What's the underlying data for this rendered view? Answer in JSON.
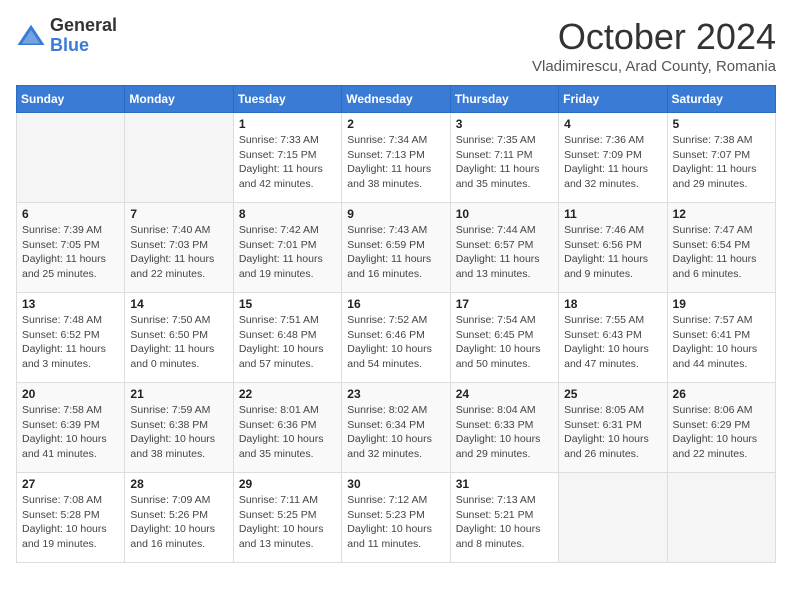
{
  "header": {
    "logo_general": "General",
    "logo_blue": "Blue",
    "month_title": "October 2024",
    "subtitle": "Vladimirescu, Arad County, Romania"
  },
  "days_of_week": [
    "Sunday",
    "Monday",
    "Tuesday",
    "Wednesday",
    "Thursday",
    "Friday",
    "Saturday"
  ],
  "weeks": [
    [
      {
        "day": "",
        "sunrise": "",
        "sunset": "",
        "daylight": ""
      },
      {
        "day": "",
        "sunrise": "",
        "sunset": "",
        "daylight": ""
      },
      {
        "day": "1",
        "sunrise": "Sunrise: 7:33 AM",
        "sunset": "Sunset: 7:15 PM",
        "daylight": "Daylight: 11 hours and 42 minutes."
      },
      {
        "day": "2",
        "sunrise": "Sunrise: 7:34 AM",
        "sunset": "Sunset: 7:13 PM",
        "daylight": "Daylight: 11 hours and 38 minutes."
      },
      {
        "day": "3",
        "sunrise": "Sunrise: 7:35 AM",
        "sunset": "Sunset: 7:11 PM",
        "daylight": "Daylight: 11 hours and 35 minutes."
      },
      {
        "day": "4",
        "sunrise": "Sunrise: 7:36 AM",
        "sunset": "Sunset: 7:09 PM",
        "daylight": "Daylight: 11 hours and 32 minutes."
      },
      {
        "day": "5",
        "sunrise": "Sunrise: 7:38 AM",
        "sunset": "Sunset: 7:07 PM",
        "daylight": "Daylight: 11 hours and 29 minutes."
      }
    ],
    [
      {
        "day": "6",
        "sunrise": "Sunrise: 7:39 AM",
        "sunset": "Sunset: 7:05 PM",
        "daylight": "Daylight: 11 hours and 25 minutes."
      },
      {
        "day": "7",
        "sunrise": "Sunrise: 7:40 AM",
        "sunset": "Sunset: 7:03 PM",
        "daylight": "Daylight: 11 hours and 22 minutes."
      },
      {
        "day": "8",
        "sunrise": "Sunrise: 7:42 AM",
        "sunset": "Sunset: 7:01 PM",
        "daylight": "Daylight: 11 hours and 19 minutes."
      },
      {
        "day": "9",
        "sunrise": "Sunrise: 7:43 AM",
        "sunset": "Sunset: 6:59 PM",
        "daylight": "Daylight: 11 hours and 16 minutes."
      },
      {
        "day": "10",
        "sunrise": "Sunrise: 7:44 AM",
        "sunset": "Sunset: 6:57 PM",
        "daylight": "Daylight: 11 hours and 13 minutes."
      },
      {
        "day": "11",
        "sunrise": "Sunrise: 7:46 AM",
        "sunset": "Sunset: 6:56 PM",
        "daylight": "Daylight: 11 hours and 9 minutes."
      },
      {
        "day": "12",
        "sunrise": "Sunrise: 7:47 AM",
        "sunset": "Sunset: 6:54 PM",
        "daylight": "Daylight: 11 hours and 6 minutes."
      }
    ],
    [
      {
        "day": "13",
        "sunrise": "Sunrise: 7:48 AM",
        "sunset": "Sunset: 6:52 PM",
        "daylight": "Daylight: 11 hours and 3 minutes."
      },
      {
        "day": "14",
        "sunrise": "Sunrise: 7:50 AM",
        "sunset": "Sunset: 6:50 PM",
        "daylight": "Daylight: 11 hours and 0 minutes."
      },
      {
        "day": "15",
        "sunrise": "Sunrise: 7:51 AM",
        "sunset": "Sunset: 6:48 PM",
        "daylight": "Daylight: 10 hours and 57 minutes."
      },
      {
        "day": "16",
        "sunrise": "Sunrise: 7:52 AM",
        "sunset": "Sunset: 6:46 PM",
        "daylight": "Daylight: 10 hours and 54 minutes."
      },
      {
        "day": "17",
        "sunrise": "Sunrise: 7:54 AM",
        "sunset": "Sunset: 6:45 PM",
        "daylight": "Daylight: 10 hours and 50 minutes."
      },
      {
        "day": "18",
        "sunrise": "Sunrise: 7:55 AM",
        "sunset": "Sunset: 6:43 PM",
        "daylight": "Daylight: 10 hours and 47 minutes."
      },
      {
        "day": "19",
        "sunrise": "Sunrise: 7:57 AM",
        "sunset": "Sunset: 6:41 PM",
        "daylight": "Daylight: 10 hours and 44 minutes."
      }
    ],
    [
      {
        "day": "20",
        "sunrise": "Sunrise: 7:58 AM",
        "sunset": "Sunset: 6:39 PM",
        "daylight": "Daylight: 10 hours and 41 minutes."
      },
      {
        "day": "21",
        "sunrise": "Sunrise: 7:59 AM",
        "sunset": "Sunset: 6:38 PM",
        "daylight": "Daylight: 10 hours and 38 minutes."
      },
      {
        "day": "22",
        "sunrise": "Sunrise: 8:01 AM",
        "sunset": "Sunset: 6:36 PM",
        "daylight": "Daylight: 10 hours and 35 minutes."
      },
      {
        "day": "23",
        "sunrise": "Sunrise: 8:02 AM",
        "sunset": "Sunset: 6:34 PM",
        "daylight": "Daylight: 10 hours and 32 minutes."
      },
      {
        "day": "24",
        "sunrise": "Sunrise: 8:04 AM",
        "sunset": "Sunset: 6:33 PM",
        "daylight": "Daylight: 10 hours and 29 minutes."
      },
      {
        "day": "25",
        "sunrise": "Sunrise: 8:05 AM",
        "sunset": "Sunset: 6:31 PM",
        "daylight": "Daylight: 10 hours and 26 minutes."
      },
      {
        "day": "26",
        "sunrise": "Sunrise: 8:06 AM",
        "sunset": "Sunset: 6:29 PM",
        "daylight": "Daylight: 10 hours and 22 minutes."
      }
    ],
    [
      {
        "day": "27",
        "sunrise": "Sunrise: 7:08 AM",
        "sunset": "Sunset: 5:28 PM",
        "daylight": "Daylight: 10 hours and 19 minutes."
      },
      {
        "day": "28",
        "sunrise": "Sunrise: 7:09 AM",
        "sunset": "Sunset: 5:26 PM",
        "daylight": "Daylight: 10 hours and 16 minutes."
      },
      {
        "day": "29",
        "sunrise": "Sunrise: 7:11 AM",
        "sunset": "Sunset: 5:25 PM",
        "daylight": "Daylight: 10 hours and 13 minutes."
      },
      {
        "day": "30",
        "sunrise": "Sunrise: 7:12 AM",
        "sunset": "Sunset: 5:23 PM",
        "daylight": "Daylight: 10 hours and 11 minutes."
      },
      {
        "day": "31",
        "sunrise": "Sunrise: 7:13 AM",
        "sunset": "Sunset: 5:21 PM",
        "daylight": "Daylight: 10 hours and 8 minutes."
      },
      {
        "day": "",
        "sunrise": "",
        "sunset": "",
        "daylight": ""
      },
      {
        "day": "",
        "sunrise": "",
        "sunset": "",
        "daylight": ""
      }
    ]
  ]
}
